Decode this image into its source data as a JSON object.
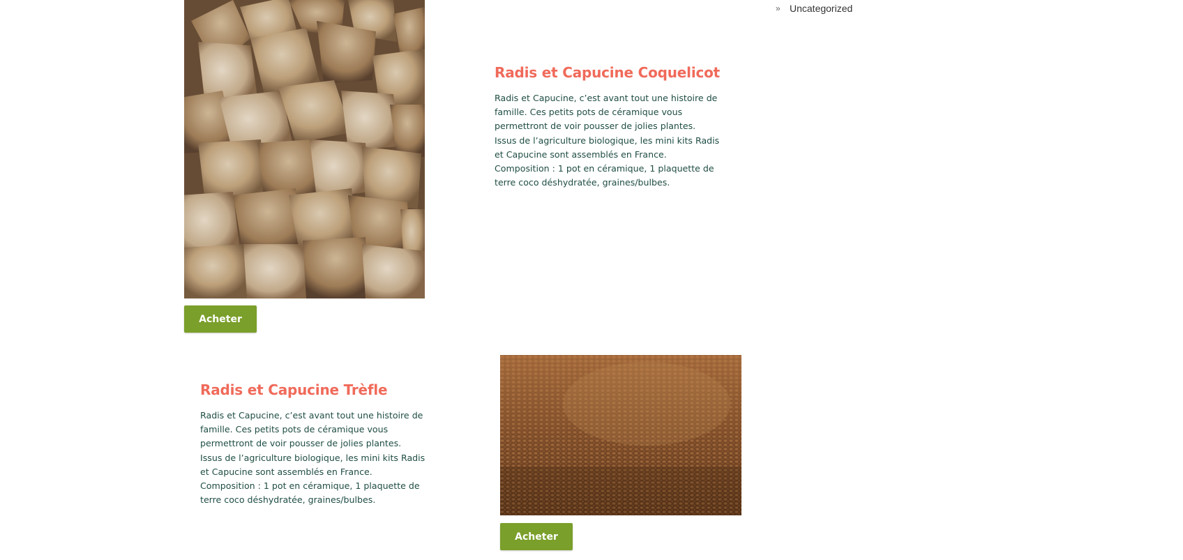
{
  "sidebar": {
    "category": {
      "icon": "double-chevron-right-icon",
      "label": "Uncategorized"
    }
  },
  "products": [
    {
      "title": "Radis et Capucine Coquelicot",
      "description": "Radis et Capucine, c’est avant tout une histoire de\nfamille. Ces petits pots de céramique vous\npermettront de voir pousser de jolies plantes.\nIssus de l’agriculture biologique, les mini kits Radis\net Capucine sont assemblés en France.\nComposition : 1 pot en céramique, 1 plaquette de\nterre coco déshydratée, graines/bulbes.",
      "image": "buckwheat-seeds-photo",
      "buy_label": "Acheter"
    },
    {
      "title": "Radis et Capucine Trèfle",
      "description": "Radis et Capucine, c’est avant tout une histoire de\nfamille. Ces petits pots de céramique vous\npermettront de voir pousser de jolies plantes.\nIssus de l’agriculture biologique, les mini kits Radis\net Capucine sont assemblés en France.\nComposition : 1 pot en céramique, 1 plaquette de\nterre coco déshydratée, graines/bulbes.",
      "image": "clover-seeds-photo",
      "buy_label": "Acheter"
    }
  ],
  "colors": {
    "title": "#f06a5a",
    "text": "#1f4d44",
    "button": "#7a9f2a"
  }
}
